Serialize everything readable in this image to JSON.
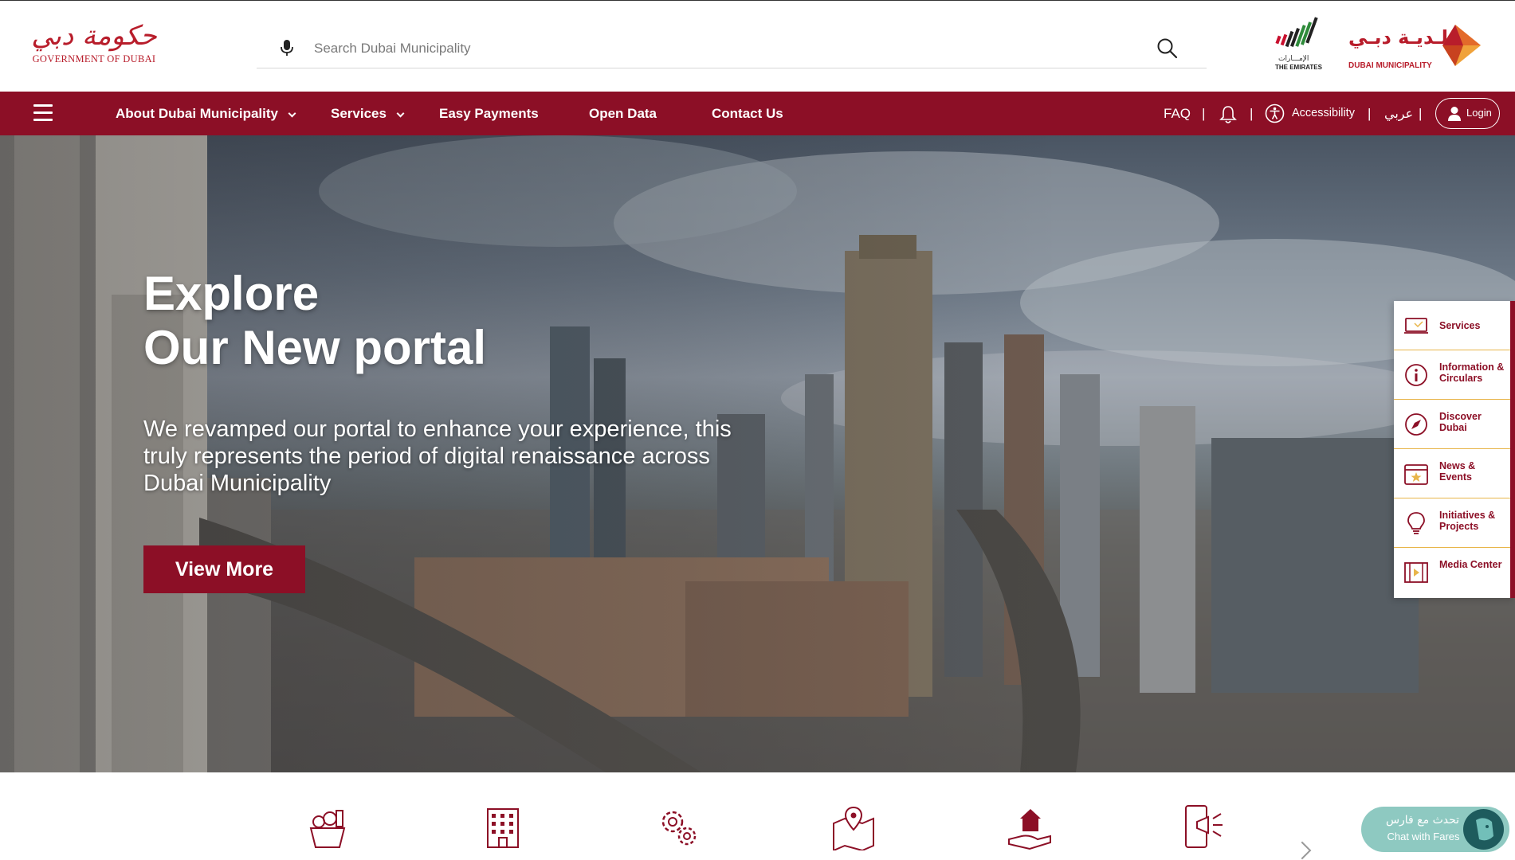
{
  "header": {
    "gov_logo": {
      "arabic": "حكومة دبي",
      "latin": "GOVERNMENT OF DUBAI"
    },
    "search": {
      "placeholder": "Search Dubai Municipality",
      "mic_icon": "microphone-icon",
      "search_icon": "search-icon"
    },
    "emirates_logo": {
      "arabic": "الإمـــارات",
      "latin": "THE EMIRATES"
    },
    "dm_logo": {
      "arabic": "بـلـديـة دبـي",
      "latin": "DUBAI MUNICIPALITY"
    }
  },
  "nav": {
    "menu_icon": "hamburger-icon",
    "items": [
      {
        "label": "About Dubai Municipality",
        "has_dropdown": true
      },
      {
        "label": "Services",
        "has_dropdown": true
      },
      {
        "label": "Easy Payments",
        "has_dropdown": false
      },
      {
        "label": "Open Data",
        "has_dropdown": false
      },
      {
        "label": "Contact Us",
        "has_dropdown": false
      }
    ],
    "right": {
      "faq": "FAQ",
      "separator": "|",
      "notification_icon": "bell-icon",
      "accessibility_icon": "accessibility-icon",
      "accessibility": "Accessibility",
      "language": "عربي",
      "login": "Login",
      "login_icon": "user-icon"
    }
  },
  "hero": {
    "title_line1": "Explore",
    "title_line2": "Our New portal",
    "description": "We revamped our portal to enhance your experience, this truly represents the period of digital renaissance across Dubai Municipality",
    "button": "View More"
  },
  "side_panel": {
    "items": [
      {
        "label": "Services",
        "icon": "laptop-icon"
      },
      {
        "label": "Information & Circulars",
        "icon": "info-icon"
      },
      {
        "label": "Discover Dubai",
        "icon": "compass-icon"
      },
      {
        "label": "News & Events",
        "icon": "calendar-star-icon"
      },
      {
        "label": "Initiatives & Projects",
        "icon": "lightbulb-icon"
      },
      {
        "label": "Media Center",
        "icon": "film-icon"
      }
    ]
  },
  "quick_icons": [
    "food-basket-icon",
    "building-icon",
    "gears-icon",
    "map-pin-icon",
    "house-hand-icon",
    "mobile-megaphone-icon"
  ],
  "chat": {
    "arabic": "تحدث مع فارس",
    "label": "Chat with Fares",
    "icon": "fares-avatar-icon"
  },
  "colors": {
    "brand": "#8c0f26",
    "accent_gold": "#e8b54a",
    "chat": "#8ec9c1"
  }
}
